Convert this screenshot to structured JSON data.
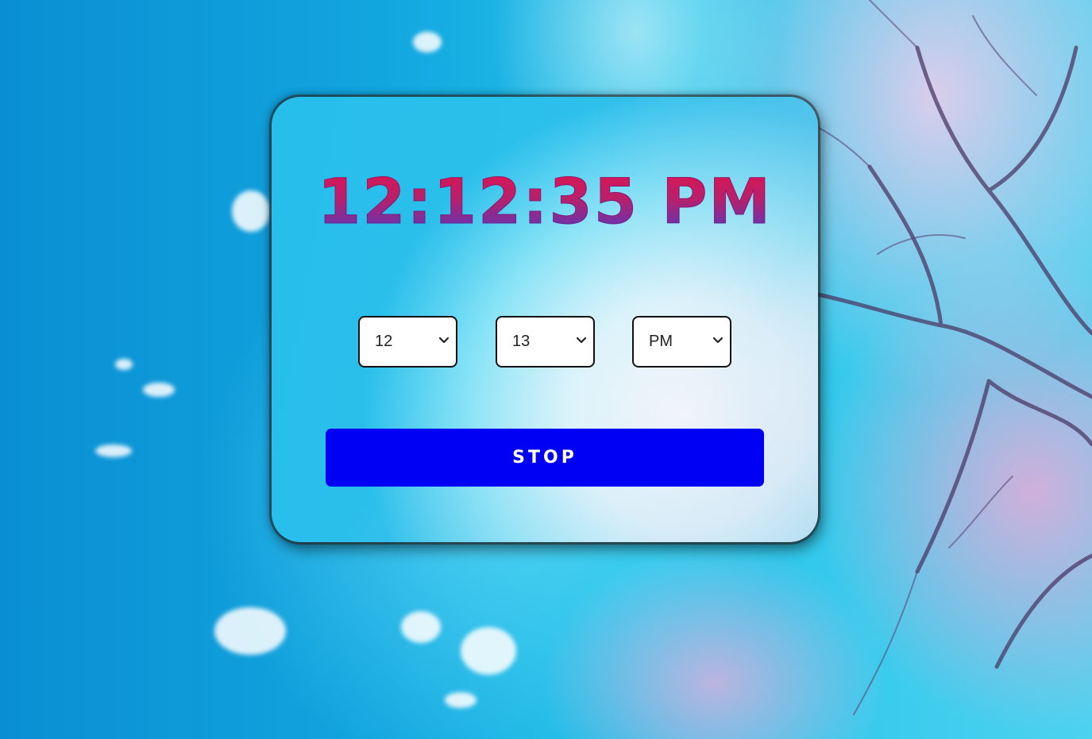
{
  "clock": {
    "time": "12:12:35 PM"
  },
  "alarm": {
    "hour": "12",
    "minute": "13",
    "ampm": "PM"
  },
  "actions": {
    "stop_label": "STOP"
  },
  "colors": {
    "button": "#0000f5",
    "time_gradient_top": "#e0134f",
    "time_gradient_bottom": "#4a3bc9"
  },
  "icons": {
    "select_arrow": "chevron-down-icon"
  }
}
